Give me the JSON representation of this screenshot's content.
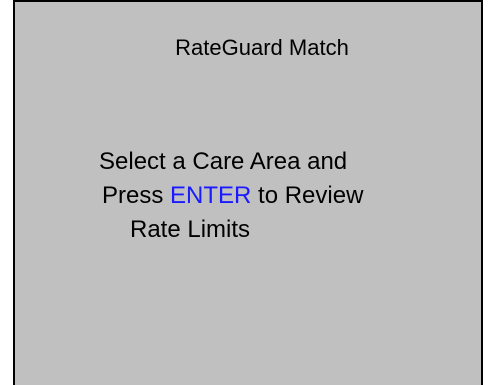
{
  "screen": {
    "title": "RateGuard Match",
    "message": {
      "line1": "Select a Care Area and",
      "line2_prefix": "Press ",
      "line2_key": "ENTER",
      "line2_suffix": " to Review",
      "line3": "Rate Limits"
    }
  },
  "colors": {
    "background": "#c0c0c0",
    "key_highlight": "#1a1aff"
  }
}
